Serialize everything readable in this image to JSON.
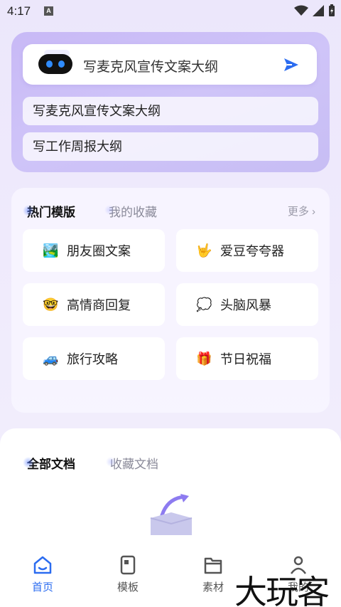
{
  "status_bar": {
    "time": "4:17",
    "indicator": "A"
  },
  "ai_card": {
    "input_text": "写麦克风宣传文案大纲",
    "suggestions": [
      "写麦克风宣传文案大纲",
      "写工作周报大纲"
    ]
  },
  "templates": {
    "tabs": [
      "热门模版",
      "我的收藏"
    ],
    "more_label": "更多 ›",
    "items": [
      {
        "icon": "🏞️",
        "label": "朋友圈文案"
      },
      {
        "icon": "🤟",
        "label": "爱豆夸夸器"
      },
      {
        "icon": "🤓",
        "label": "高情商回复"
      },
      {
        "icon": "💭",
        "label": "头脑风暴"
      },
      {
        "icon": "🚙",
        "label": "旅行攻略"
      },
      {
        "icon": "🎁",
        "label": "节日祝福"
      }
    ]
  },
  "documents": {
    "tabs": [
      "全部文档",
      "收藏文档"
    ]
  },
  "bottom_nav": {
    "items": [
      {
        "label": "首页",
        "icon": "home-icon"
      },
      {
        "label": "模板",
        "icon": "template-icon"
      },
      {
        "label": "素材",
        "icon": "folder-icon"
      },
      {
        "label": "我的",
        "icon": "user-icon"
      }
    ],
    "active_color": "#2b6cf0"
  },
  "watermark": "大玩客",
  "colors": {
    "accent": "#2b6cf0",
    "card_purple": "#c8b9f6"
  }
}
